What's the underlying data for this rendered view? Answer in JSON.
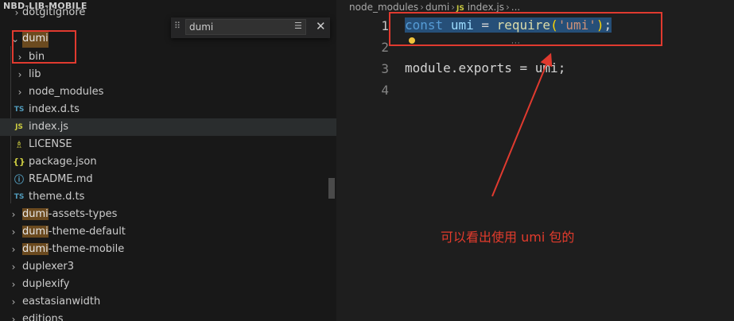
{
  "sidebar": {
    "title": "NBD-LIB-MOBILE",
    "items": [
      {
        "label": "dotgitignore",
        "kind": "folder",
        "icon": "chevron-right-icon"
      },
      {
        "label": "dumi",
        "kind": "folder-open",
        "icon": "chevron-down-icon"
      },
      {
        "label": "bin",
        "kind": "folder",
        "icon": "chevron-right-icon"
      },
      {
        "label": "lib",
        "kind": "folder",
        "icon": "chevron-right-icon"
      },
      {
        "label": "node_modules",
        "kind": "folder",
        "icon": "chevron-right-icon"
      },
      {
        "label": "index.d.ts",
        "kind": "file",
        "icon_text": "TS"
      },
      {
        "label": "index.js",
        "kind": "file",
        "icon_text": "JS"
      },
      {
        "label": "LICENSE",
        "kind": "file",
        "icon_text": "ℹ"
      },
      {
        "label": "package.json",
        "kind": "file",
        "icon_text": "{}"
      },
      {
        "label": "README.md",
        "kind": "file",
        "icon_text": "ⓘ"
      },
      {
        "label": "theme.d.ts",
        "kind": "file",
        "icon_text": "TS"
      },
      {
        "label_match": "dumi",
        "label_rest": "-assets-types",
        "kind": "folder"
      },
      {
        "label_match": "dumi",
        "label_rest": "-theme-default",
        "kind": "folder"
      },
      {
        "label_match": "dumi",
        "label_rest": "-theme-mobile",
        "kind": "folder"
      },
      {
        "label": "duplexer3",
        "kind": "folder"
      },
      {
        "label": "duplexify",
        "kind": "folder"
      },
      {
        "label": "eastasianwidth",
        "kind": "folder"
      },
      {
        "label": "editions",
        "kind": "folder"
      }
    ]
  },
  "find_widget": {
    "value": "dumi",
    "filter_icon": "filter-icon",
    "close_icon": "close-icon"
  },
  "editor": {
    "breadcrumb": {
      "part1": "node_modules",
      "part2": "dumi",
      "file_icon_text": "JS",
      "part3": "index.js",
      "part4": "..."
    },
    "line_numbers": [
      "1",
      "2",
      "3",
      "4"
    ],
    "code": {
      "line1": {
        "t1": "const",
        "t2": " ",
        "t3": "umi",
        "t4": " = ",
        "t5": "require",
        "t6": "(",
        "t7": "'umi'",
        "t8": ")",
        "t9": ";"
      },
      "line3": {
        "t1": "module",
        "t2": ".",
        "t3": "exports",
        "t4": " = ",
        "t5": "umi",
        "t6": ";"
      }
    }
  },
  "annotation": {
    "text": "可以看出使用 umi 包的",
    "color": "#e23b2c"
  },
  "colors": {
    "highlight_red": "#e03a2f",
    "keyword": "#569cd6",
    "string": "#ce9178"
  }
}
